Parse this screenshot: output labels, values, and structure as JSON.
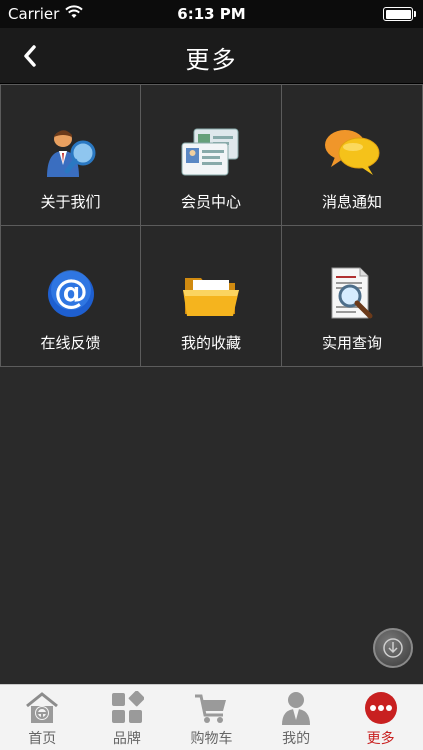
{
  "status_bar": {
    "carrier": "Carrier",
    "time": "6:13 PM"
  },
  "nav": {
    "title": "更多"
  },
  "grid": [
    {
      "label": "关于我们",
      "icon": "about-us-icon"
    },
    {
      "label": "会员中心",
      "icon": "member-card-icon"
    },
    {
      "label": "消息通知",
      "icon": "chat-bubbles-icon"
    },
    {
      "label": "在线反馈",
      "icon": "at-sign-icon"
    },
    {
      "label": "我的收藏",
      "icon": "folder-icon"
    },
    {
      "label": "实用查询",
      "icon": "document-search-icon"
    }
  ],
  "tabs": [
    {
      "label": "首页",
      "icon": "home-icon"
    },
    {
      "label": "品牌",
      "icon": "brand-grid-icon"
    },
    {
      "label": "购物车",
      "icon": "cart-icon"
    },
    {
      "label": "我的",
      "icon": "user-icon"
    },
    {
      "label": "更多",
      "icon": "more-dots-icon",
      "active": true
    }
  ],
  "colors": {
    "accent": "#c82020",
    "background": "#2a2a2a",
    "grid_line": "#5c5c5c"
  }
}
